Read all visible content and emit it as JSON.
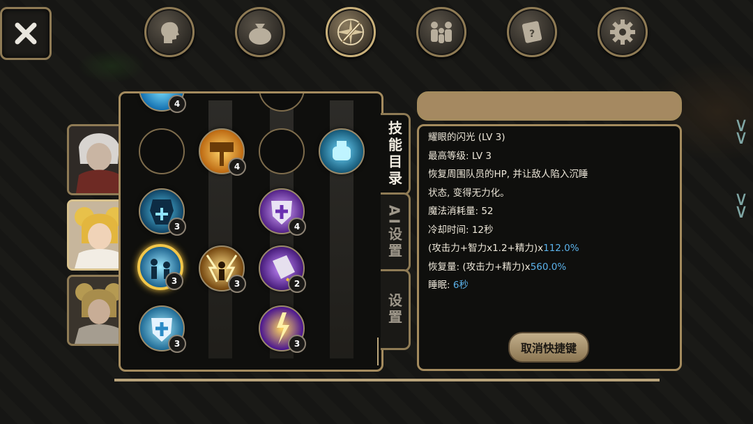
{
  "topbar": {
    "close_icon": "close-icon",
    "tabs": [
      {
        "name": "character",
        "icon": "head-icon"
      },
      {
        "name": "inventory",
        "icon": "bag-icon"
      },
      {
        "name": "skills",
        "icon": "sword-compass-icon",
        "active": true
      },
      {
        "name": "party",
        "icon": "party-icon"
      },
      {
        "name": "quest",
        "icon": "scroll-icon"
      },
      {
        "name": "settings",
        "icon": "gear-icon"
      }
    ]
  },
  "party": {
    "members": [
      {
        "id": "white-haired-hero",
        "selected": false
      },
      {
        "id": "blonde-healer",
        "selected": true
      },
      {
        "id": "blonde-mage",
        "selected": false
      }
    ]
  },
  "side_tabs": {
    "skills": "技能目录",
    "ai": "AI设置",
    "settings": "设置"
  },
  "skill_levels": {
    "top_partial": "4",
    "hammer": "4",
    "potion": "",
    "armor": "3",
    "shield_purple": "4",
    "flash": "3",
    "lightning_guard": "3",
    "sword_purple": "2",
    "shield_blue": "3",
    "purple_flame": "3"
  },
  "detail": {
    "header_bar": "",
    "name": "耀眼的闪光 (LV 3)",
    "max_level": "最高等级:  LV 3",
    "desc1": "恢复周围队员的HP, 并让敌人陷入沉睡",
    "desc2": "状态, 变得无力化。",
    "mana": "魔法消耗量: 52",
    "cooldown": "冷却时间: 12秒",
    "formula1_text": "(攻击力+智力x1.2+精力)x",
    "formula1_val": "112.0%",
    "formula2_text": "恢复量: (攻击力+精力)x",
    "formula2_val": "560.0%",
    "sleep_label": "睡眠: ",
    "sleep_val": "6秒",
    "cancel_button": "取消快捷键"
  },
  "colors": {
    "frame": "#a48b5e",
    "highlight": "#5bb2ea",
    "selected_ring": "#f2c64a"
  }
}
